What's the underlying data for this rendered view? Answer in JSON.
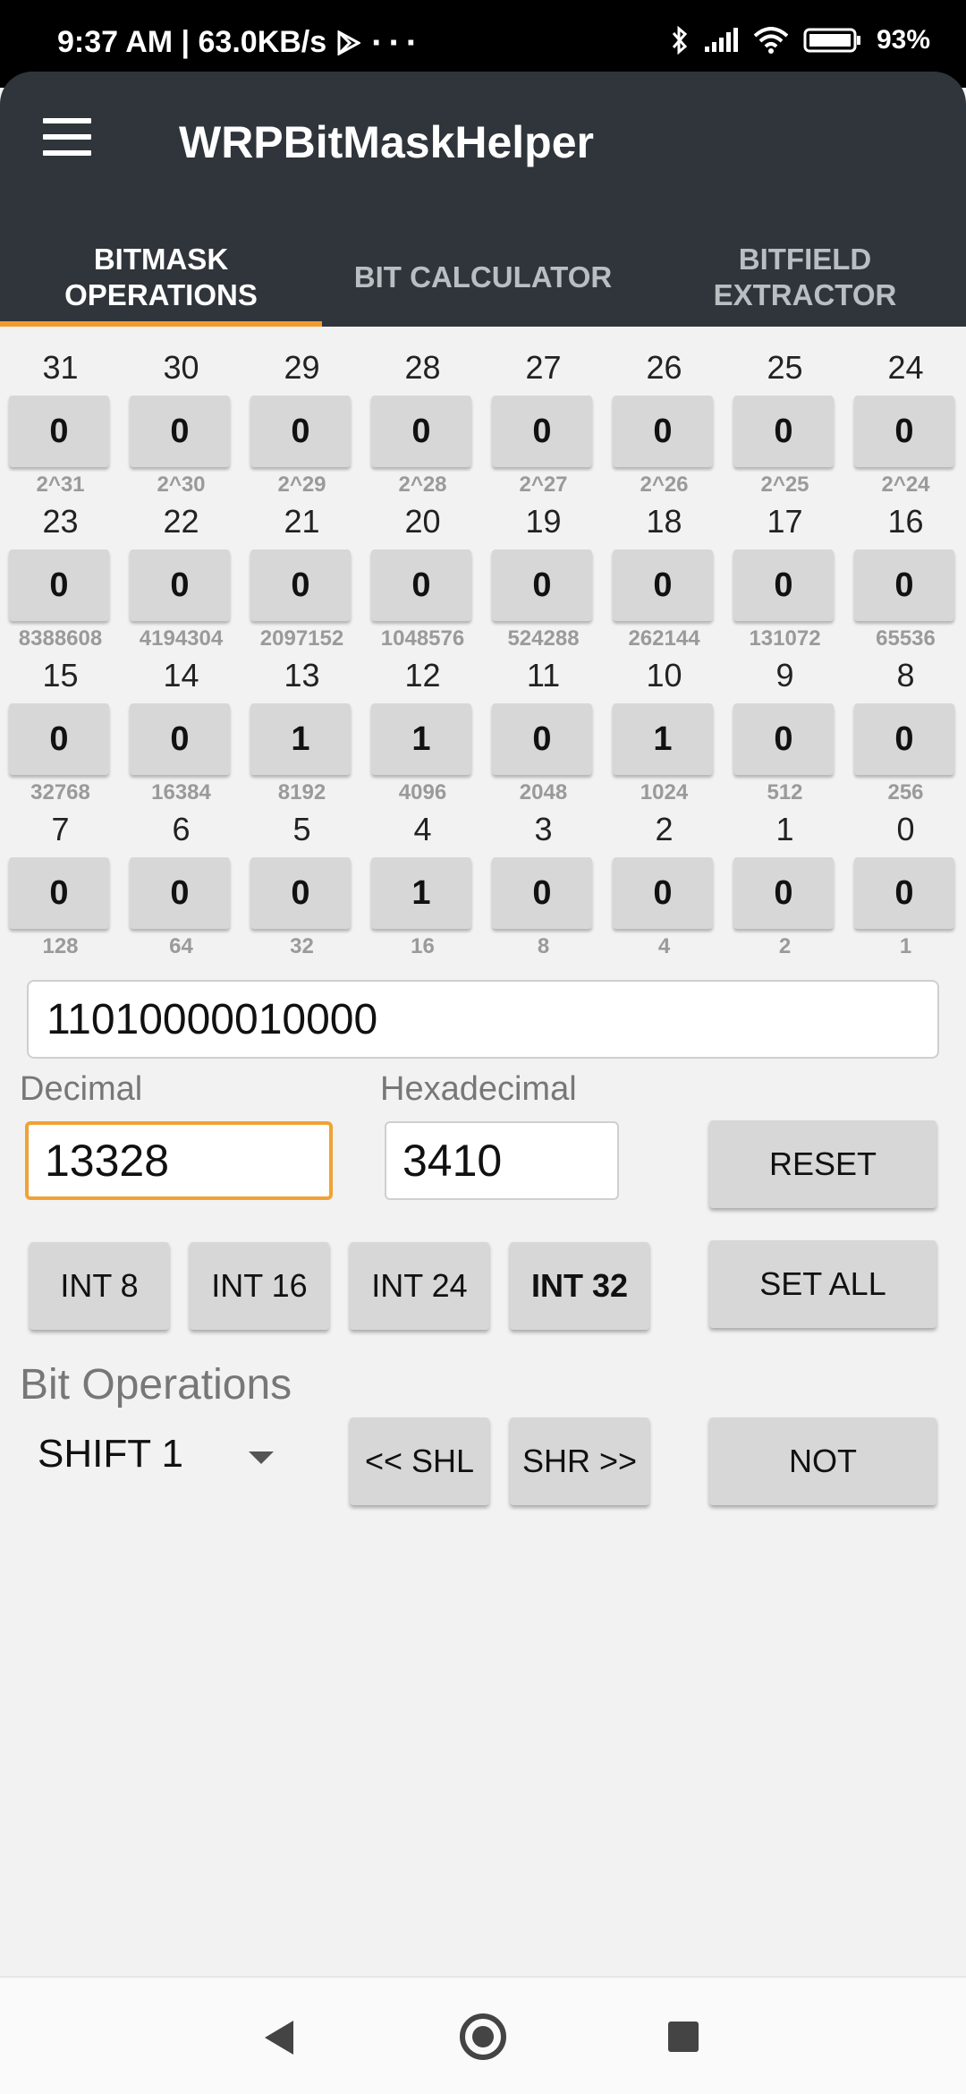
{
  "status": {
    "time_speed": "9:37 AM | 63.0KB/s",
    "dots": "···",
    "battery": "93%"
  },
  "app": {
    "title": "WRPBitMaskHelper"
  },
  "tabs": [
    {
      "label": "BITMASK OPERATIONS",
      "active": true
    },
    {
      "label": "BIT CALCULATOR",
      "active": false
    },
    {
      "label": "BITFIELD EXTRACTOR",
      "active": false
    }
  ],
  "bits": {
    "rows": [
      [
        {
          "idx": "31",
          "bit": "0",
          "pw": "2^31"
        },
        {
          "idx": "30",
          "bit": "0",
          "pw": "2^30"
        },
        {
          "idx": "29",
          "bit": "0",
          "pw": "2^29"
        },
        {
          "idx": "28",
          "bit": "0",
          "pw": "2^28"
        },
        {
          "idx": "27",
          "bit": "0",
          "pw": "2^27"
        },
        {
          "idx": "26",
          "bit": "0",
          "pw": "2^26"
        },
        {
          "idx": "25",
          "bit": "0",
          "pw": "2^25"
        },
        {
          "idx": "24",
          "bit": "0",
          "pw": "2^24"
        }
      ],
      [
        {
          "idx": "23",
          "bit": "0",
          "pw": "8388608"
        },
        {
          "idx": "22",
          "bit": "0",
          "pw": "4194304"
        },
        {
          "idx": "21",
          "bit": "0",
          "pw": "2097152"
        },
        {
          "idx": "20",
          "bit": "0",
          "pw": "1048576"
        },
        {
          "idx": "19",
          "bit": "0",
          "pw": "524288"
        },
        {
          "idx": "18",
          "bit": "0",
          "pw": "262144"
        },
        {
          "idx": "17",
          "bit": "0",
          "pw": "131072"
        },
        {
          "idx": "16",
          "bit": "0",
          "pw": "65536"
        }
      ],
      [
        {
          "idx": "15",
          "bit": "0",
          "pw": "32768"
        },
        {
          "idx": "14",
          "bit": "0",
          "pw": "16384"
        },
        {
          "idx": "13",
          "bit": "1",
          "pw": "8192"
        },
        {
          "idx": "12",
          "bit": "1",
          "pw": "4096"
        },
        {
          "idx": "11",
          "bit": "0",
          "pw": "2048"
        },
        {
          "idx": "10",
          "bit": "1",
          "pw": "1024"
        },
        {
          "idx": "9",
          "bit": "0",
          "pw": "512"
        },
        {
          "idx": "8",
          "bit": "0",
          "pw": "256"
        }
      ],
      [
        {
          "idx": "7",
          "bit": "0",
          "pw": "128"
        },
        {
          "idx": "6",
          "bit": "0",
          "pw": "64"
        },
        {
          "idx": "5",
          "bit": "0",
          "pw": "32"
        },
        {
          "idx": "4",
          "bit": "1",
          "pw": "16"
        },
        {
          "idx": "3",
          "bit": "0",
          "pw": "8"
        },
        {
          "idx": "2",
          "bit": "0",
          "pw": "4"
        },
        {
          "idx": "1",
          "bit": "0",
          "pw": "2"
        },
        {
          "idx": "0",
          "bit": "0",
          "pw": "1"
        }
      ]
    ]
  },
  "binary_value": "11010000010000",
  "decimal": {
    "label": "Decimal",
    "value": "13328"
  },
  "hexadecimal": {
    "label": "Hexadecimal",
    "value": "3410"
  },
  "buttons": {
    "reset": "RESET",
    "set_all": "SET ALL",
    "int8": "INT 8",
    "int16": "INT 16",
    "int24": "INT 24",
    "int32": "INT 32",
    "shl": "<< SHL",
    "shr": "SHR >>",
    "not": "NOT"
  },
  "bit_operations": {
    "title": "Bit Operations",
    "shift_selected": "SHIFT 1"
  },
  "colors": {
    "appbar": "#2f353a",
    "accent": "#f39a2e",
    "button": "#d7d7d7"
  }
}
